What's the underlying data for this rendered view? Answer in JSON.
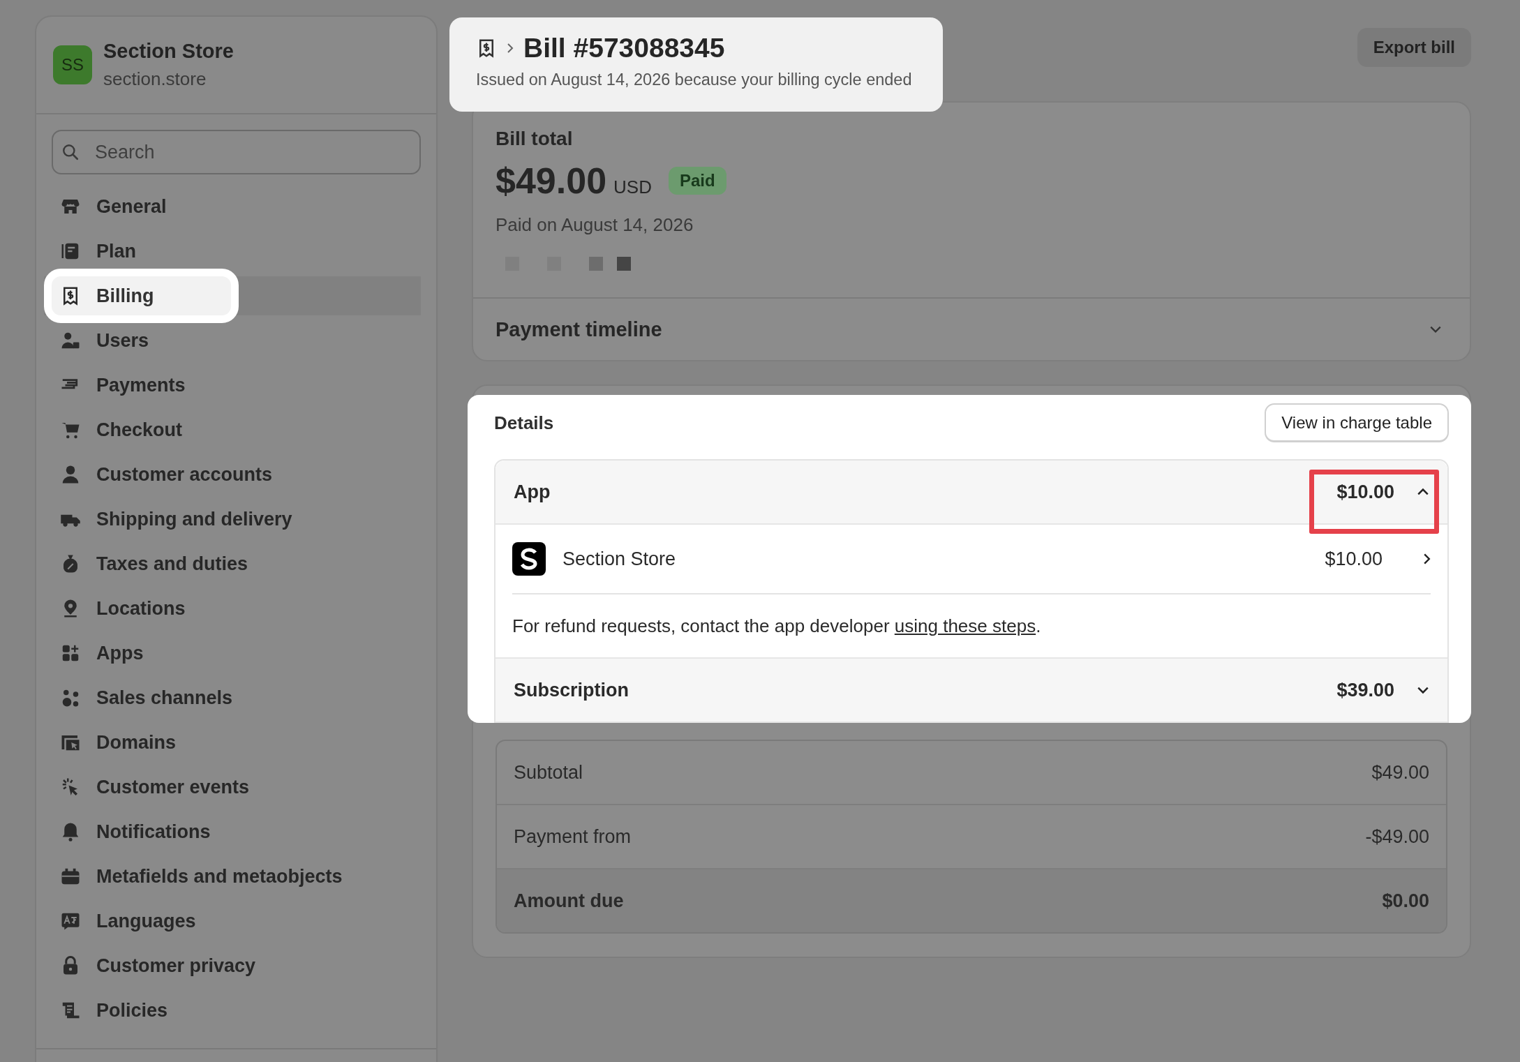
{
  "store": {
    "initials": "SS",
    "name": "Section Store",
    "domain": "section.store"
  },
  "search": {
    "placeholder": "Search"
  },
  "nav": [
    {
      "label": "General",
      "selected": false
    },
    {
      "label": "Plan",
      "selected": false
    },
    {
      "label": "Billing",
      "selected": true
    },
    {
      "label": "Users",
      "selected": false
    },
    {
      "label": "Payments",
      "selected": false
    },
    {
      "label": "Checkout",
      "selected": false
    },
    {
      "label": "Customer accounts",
      "selected": false
    },
    {
      "label": "Shipping and delivery",
      "selected": false
    },
    {
      "label": "Taxes and duties",
      "selected": false
    },
    {
      "label": "Locations",
      "selected": false
    },
    {
      "label": "Apps",
      "selected": false
    },
    {
      "label": "Sales channels",
      "selected": false
    },
    {
      "label": "Domains",
      "selected": false
    },
    {
      "label": "Customer events",
      "selected": false
    },
    {
      "label": "Notifications",
      "selected": false
    },
    {
      "label": "Metafields and metaobjects",
      "selected": false
    },
    {
      "label": "Languages",
      "selected": false
    },
    {
      "label": "Customer privacy",
      "selected": false
    },
    {
      "label": "Policies",
      "selected": false
    }
  ],
  "header": {
    "title": "Bill #573088345",
    "subtitle": "Issued on August 14, 2026 because your billing cycle ended"
  },
  "export_button": "Export bill",
  "bill_total": {
    "label": "Bill total",
    "amount": "$49.00",
    "currency": "USD",
    "status": "Paid",
    "paid_on": "Paid on August 14, 2026",
    "timeline": "Payment timeline",
    "timeline_expanded": false
  },
  "details": {
    "title": "Details",
    "button": "View in charge table",
    "groups": [
      {
        "name": "App",
        "amount": "$10.00",
        "expanded": true,
        "annotated": true,
        "items": [
          {
            "name": "Section Store",
            "amount": "$10.00"
          }
        ],
        "note": "For refund requests, contact the app developer ",
        "note_link": "using these steps",
        "note_end": "."
      },
      {
        "name": "Subscription",
        "amount": "$39.00",
        "expanded": false,
        "annotated": false
      }
    ]
  },
  "totals": [
    {
      "label": "Subtotal",
      "amount": "$49.00",
      "kind": "line"
    },
    {
      "label": "Payment from",
      "amount": "-$49.00",
      "kind": "line"
    },
    {
      "label": "Amount due",
      "amount": "$0.00",
      "kind": "total"
    }
  ]
}
